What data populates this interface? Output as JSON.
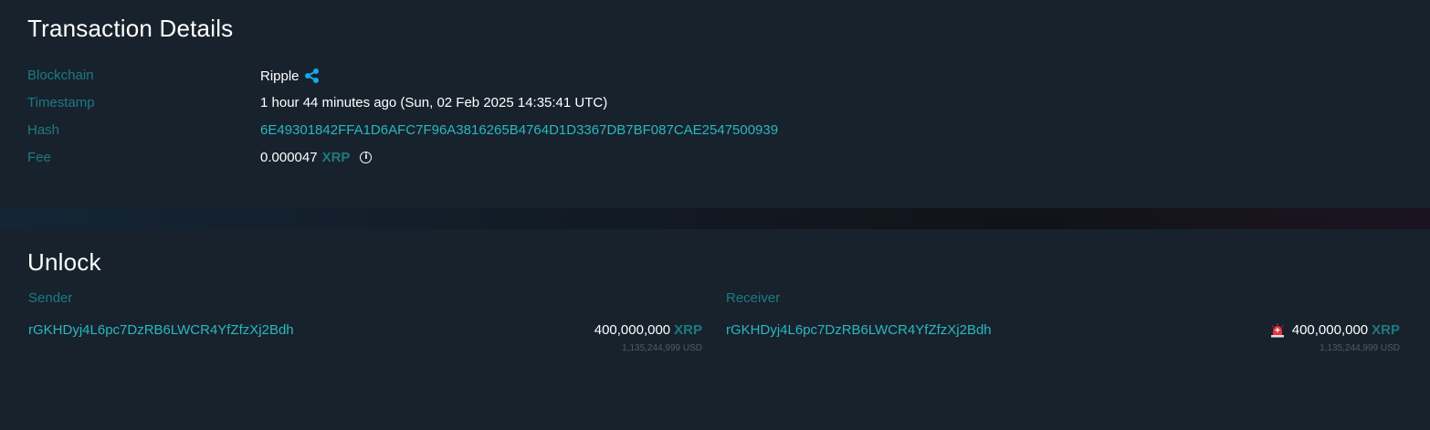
{
  "details": {
    "title": "Transaction Details",
    "rows": [
      {
        "label": "Blockchain",
        "value": "Ripple"
      },
      {
        "label": "Timestamp",
        "value": "1 hour 44 minutes ago (Sun, 02 Feb 2025 14:35:41 UTC)"
      },
      {
        "label": "Hash",
        "value": "6E49301842FFA1D6AFC7F96A3816265B4764D1D3367DB7BF087CAE2547500939"
      },
      {
        "label": "Fee",
        "value": "0.000047",
        "unit": "XRP"
      }
    ]
  },
  "unlock": {
    "title": "Unlock",
    "sender": {
      "header": "Sender",
      "address": "rGKHDyj4L6pc7DzRB6LWCR4YfZfzXj2Bdh",
      "amount": "400,000,000",
      "unit": "XRP",
      "usd": "1,135,244,999 USD"
    },
    "receiver": {
      "header": "Receiver",
      "address": "rGKHDyj4L6pc7DzRB6LWCR4YfZfzXj2Bdh",
      "amount": "400,000,000",
      "unit": "XRP",
      "usd": "1,135,244,999 USD",
      "icon": "alarm-siren-icon"
    }
  },
  "colors": {
    "background": "#17222c",
    "label": "#1d7a82",
    "link": "#2bb7be",
    "text": "#ffffff"
  }
}
